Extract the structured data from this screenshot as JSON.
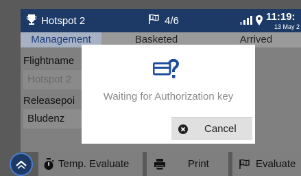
{
  "status_bar": {
    "hotspot_name": "Hotspot 2",
    "progress": "4/6",
    "time": "11:19:",
    "date": "13 May 2"
  },
  "tabs": [
    {
      "label": "Management",
      "active": true
    },
    {
      "label": "Basketed",
      "active": false
    },
    {
      "label": "Arrived",
      "active": false
    }
  ],
  "form": {
    "flightname_label": "Flightname",
    "flightname_value": "Hotspot 2",
    "releasepoint_label": "Releasepoi",
    "releasepoint_value": "Bludenz"
  },
  "bottom_bar": {
    "temp_evaluate_label": "Temp. Evaluate",
    "print_label": "Print",
    "evaluate_label": "Evaluate"
  },
  "dialog": {
    "message": "Waiting for Authorization key",
    "cancel_label": "Cancel"
  },
  "colors": {
    "status_bar_bg": "#1d3a66",
    "active_tab_bg": "#a6b2c4",
    "active_tab_text": "#1a3a7a",
    "dialog_icon": "#1f4e9e"
  }
}
